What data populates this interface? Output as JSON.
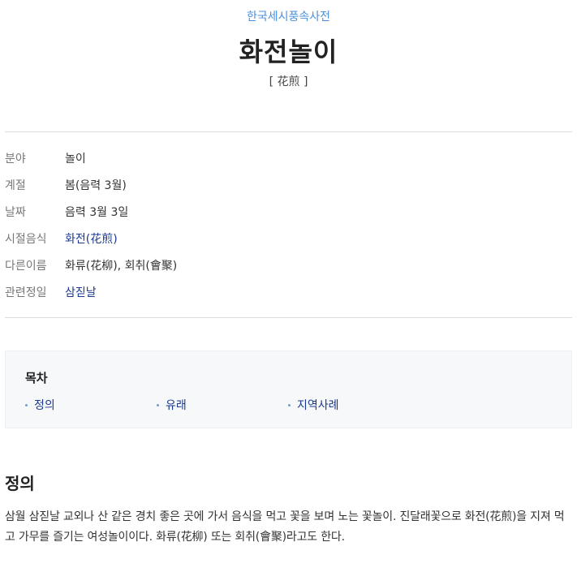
{
  "header": {
    "dictionary_name": "한국세시풍속사전",
    "title": "화전놀이",
    "hanja": "[ 花煎 ]"
  },
  "info": {
    "rows": [
      {
        "key": "분야",
        "value": "놀이"
      },
      {
        "key": "계절",
        "value": "봄(음력 3월)"
      },
      {
        "key": "날짜",
        "value": "음력 3월 3일"
      },
      {
        "key": "시절음식",
        "value": "화전(花煎)"
      },
      {
        "key": "다른이름",
        "value": "화류(花柳), 회취(會聚)"
      },
      {
        "key": "관련정일",
        "value": "삼짇날"
      }
    ]
  },
  "toc": {
    "title": "목차",
    "items": [
      "정의",
      "유래",
      "지역사례"
    ]
  },
  "section": {
    "title": "정의",
    "body": "삼월 삼짇날 교외나 산 같은 경치 좋은 곳에 가서 음식을 먹고 꽃을 보며 노는 꽃놀이. 진달래꽃으로 화전(花煎)을 지져 먹고 가무를 즐기는 여성놀이이다. 화류(花柳) 또는 회취(會聚)라고도 한다."
  }
}
